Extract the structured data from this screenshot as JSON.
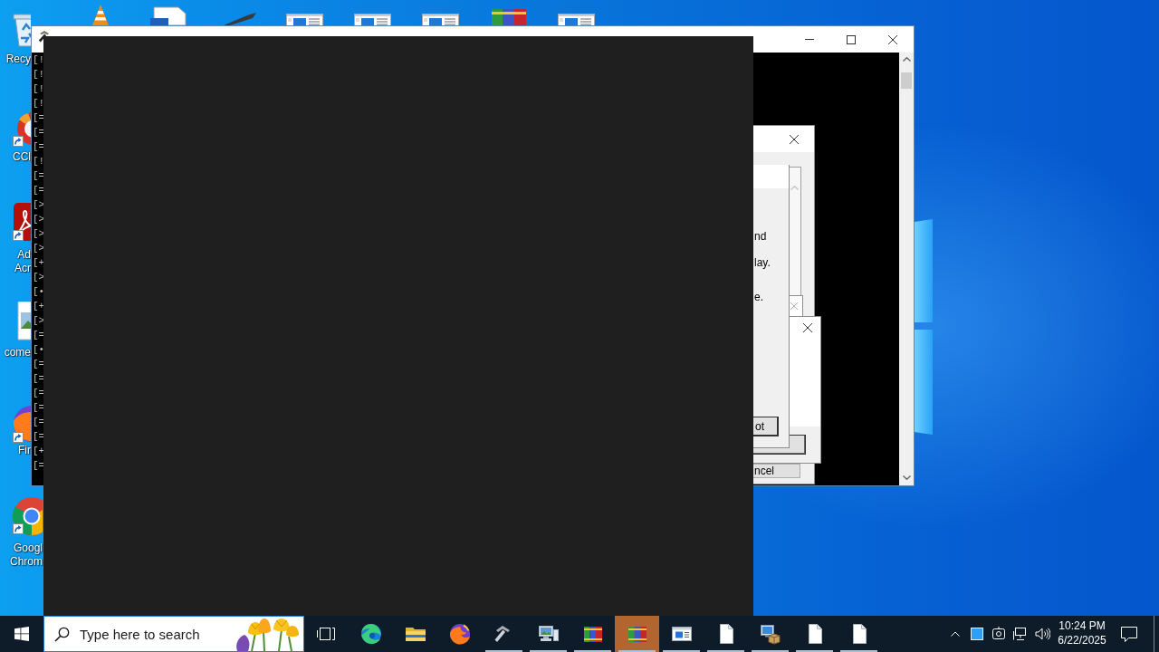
{
  "desktop": {
    "shortcuts": [
      {
        "label": "Recy",
        "kind": "recycle-bin",
        "shortcut": false
      },
      {
        "label": "CCl",
        "kind": "cleaner",
        "shortcut": true
      },
      {
        "label": "Ad Acr",
        "kind": "pdf",
        "shortcut": true
      },
      {
        "label": "come",
        "kind": "image",
        "shortcut": false
      },
      {
        "label": "Fir",
        "kind": "fox",
        "shortcut": true
      },
      {
        "label": "Googl Chrom",
        "kind": "chrome",
        "shortcut": true
      }
    ],
    "top_icons": [
      {
        "kind": "cone"
      },
      {
        "kind": "document"
      },
      {
        "kind": "tool"
      },
      {
        "kind": "window"
      },
      {
        "kind": "window"
      },
      {
        "kind": "window"
      },
      {
        "kind": "books"
      },
      {
        "kind": "window"
      }
    ]
  },
  "console": {
    "lines": [
      "[!",
      "[!",
      "[!",
      "[!",
      "[=",
      "[=",
      "[=",
      "[!",
      "[=",
      "[=",
      "[>",
      "[>",
      "[>",
      "[>",
      "[+",
      "[>",
      "[•",
      "[+",
      "[>",
      "[=",
      "[•",
      "[=",
      "[=",
      "[=",
      "[=",
      "[=",
      "[=",
      "[+",
      "[="
    ]
  },
  "dialogs": [
    {
      "kind": "prompt",
      "lines": [
        "nd",
        "lay.",
        "e."
      ],
      "button": "ot"
    },
    {
      "kind": "message"
    },
    {
      "kind": "small"
    },
    {
      "kind": "viewer",
      "button": "ncel"
    }
  ],
  "taskbar": {
    "search": {
      "placeholder": "Type here to search"
    },
    "apps": [
      {
        "kind": "task-view",
        "running": false,
        "attention": false
      },
      {
        "kind": "edge",
        "running": false,
        "attention": false
      },
      {
        "kind": "folder",
        "running": false,
        "attention": false
      },
      {
        "kind": "fox",
        "running": false,
        "attention": false
      },
      {
        "kind": "hammer",
        "running": true,
        "attention": false
      },
      {
        "kind": "computer",
        "running": true,
        "attention": false
      },
      {
        "kind": "books",
        "running": true,
        "attention": false
      },
      {
        "kind": "books",
        "running": true,
        "attention": true
      },
      {
        "kind": "window",
        "running": true,
        "attention": false
      },
      {
        "kind": "document",
        "running": true,
        "attention": false
      },
      {
        "kind": "installer",
        "running": true,
        "attention": false
      },
      {
        "kind": "document",
        "running": true,
        "attention": false
      },
      {
        "kind": "document",
        "running": true,
        "attention": false
      }
    ],
    "clock": {
      "time": "10:24 PM",
      "date": "6/22/2025"
    }
  }
}
